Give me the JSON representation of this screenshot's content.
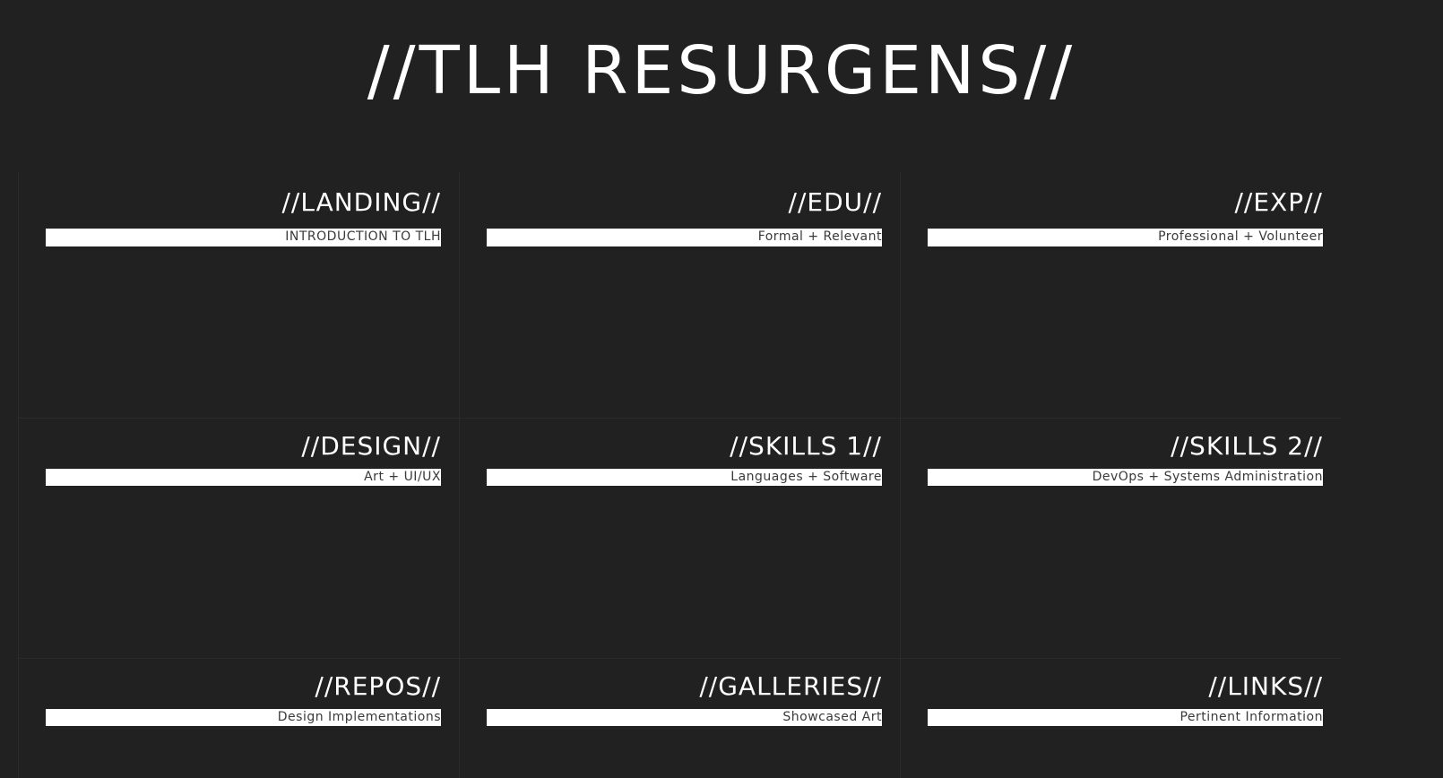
{
  "site": {
    "title": "//TLH RESURGENS//"
  },
  "sections": [
    {
      "title": "//LANDING//",
      "subtitle": "INTRODUCTION TO TLH"
    },
    {
      "title": "//EDU//",
      "subtitle": "Formal + Relevant"
    },
    {
      "title": "//EXP//",
      "subtitle": "Professional + Volunteer"
    },
    {
      "title": "//DESIGN//",
      "subtitle": "Art + UI/UX"
    },
    {
      "title": "//SKILLS 1//",
      "subtitle": "Languages + Software"
    },
    {
      "title": "//SKILLS 2//",
      "subtitle": "DevOps + Systems Administration"
    },
    {
      "title": "//REPOS//",
      "subtitle": "Design Implementations"
    },
    {
      "title": "//GALLERIES//",
      "subtitle": "Showcased Art"
    },
    {
      "title": "//LINKS//",
      "subtitle": "Pertinent Information"
    }
  ]
}
